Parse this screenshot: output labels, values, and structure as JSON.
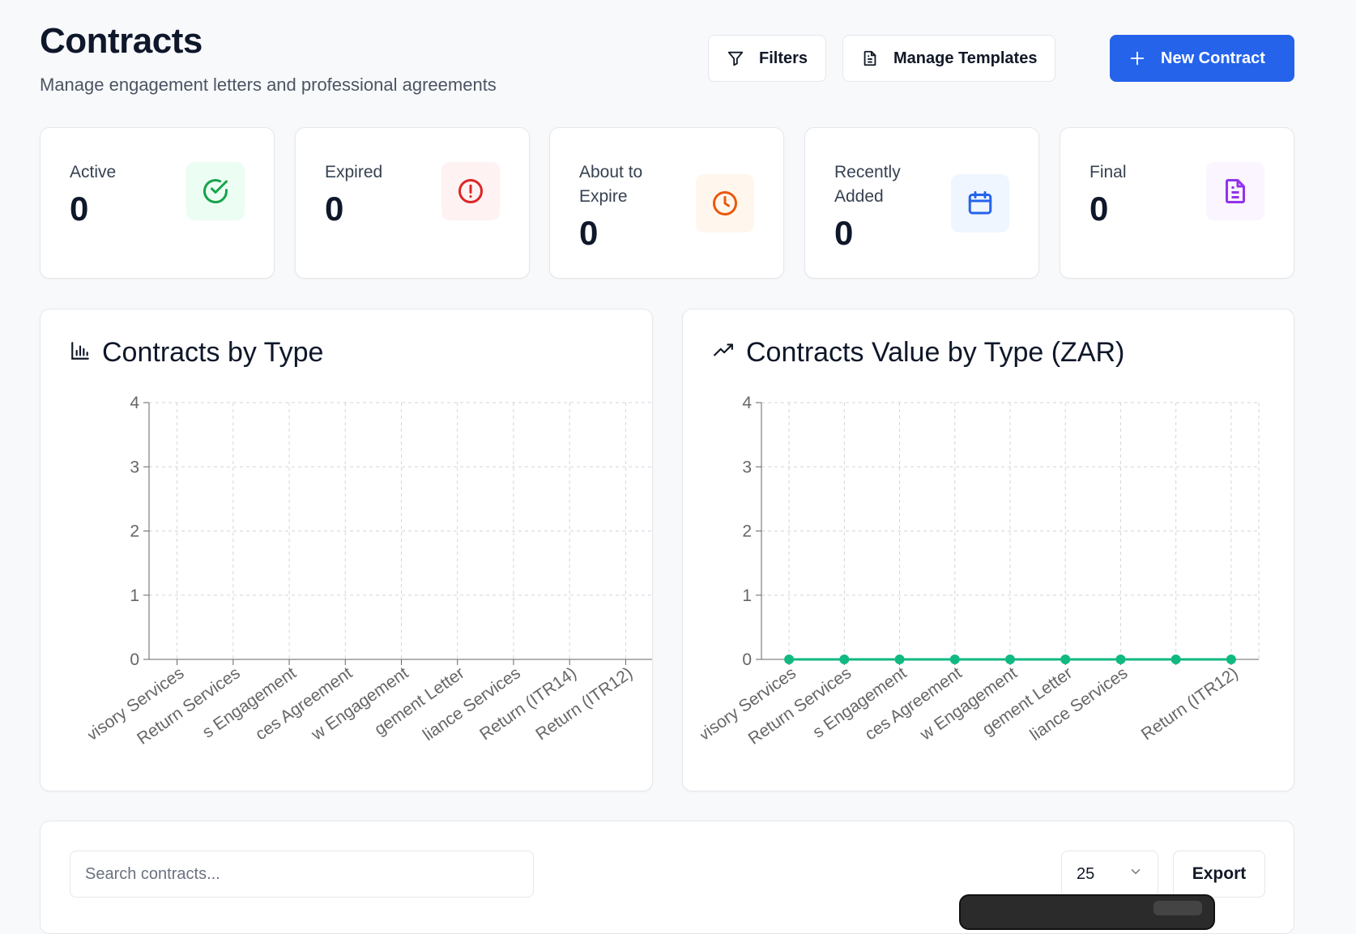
{
  "header": {
    "title": "Contracts",
    "subtitle": "Manage engagement letters and professional agreements",
    "buttons": {
      "filters": "Filters",
      "manage_templates": "Manage Templates",
      "new_contract": "New Contract"
    }
  },
  "stats": [
    {
      "label": "Active",
      "value": "0",
      "icon": "check-circle-icon",
      "color": "#16a34a",
      "bg": "#ecfdf3"
    },
    {
      "label": "Expired",
      "value": "0",
      "icon": "alert-circle-icon",
      "color": "#dc2626",
      "bg": "#fef2f2"
    },
    {
      "label": "About to Expire",
      "value": "0",
      "icon": "clock-icon",
      "color": "#ea580c",
      "bg": "#fff7ed"
    },
    {
      "label": "Recently Added",
      "value": "0",
      "icon": "calendar-icon",
      "color": "#2563eb",
      "bg": "#eff6ff"
    },
    {
      "label": "Final",
      "value": "0",
      "icon": "file-text-icon",
      "color": "#9333ea",
      "bg": "#faf5ff"
    }
  ],
  "charts": {
    "by_type_title": "Contracts by Type",
    "value_title": "Contracts Value by Type (ZAR)"
  },
  "chart_data": [
    {
      "type": "bar",
      "title": "Contracts by Type",
      "categories": [
        "visory Services",
        "Return Services",
        "s Engagement",
        "ces Agreement",
        "w Engagement",
        "gement Letter",
        "liance Services",
        "Return (ITR14)",
        "Return (ITR12)"
      ],
      "values": [
        0,
        0,
        0,
        0,
        0,
        0,
        0,
        0,
        0
      ],
      "yticks": [
        0,
        1,
        2,
        3,
        4
      ],
      "ylim": [
        0,
        4
      ],
      "grid": true
    },
    {
      "type": "line",
      "title": "Contracts Value by Type (ZAR)",
      "categories": [
        "visory Services",
        "Return Services",
        "s Engagement",
        "ces Agreement",
        "w Engagement",
        "gement Letter",
        "liance Services",
        "",
        "Return (ITR12)"
      ],
      "values": [
        0,
        0,
        0,
        0,
        0,
        0,
        0,
        0,
        0
      ],
      "yticks": [
        0,
        1,
        2,
        3,
        4
      ],
      "ylim": [
        0,
        4
      ],
      "grid": true,
      "color": "#10b981"
    }
  ],
  "table": {
    "search_placeholder": "Search contracts...",
    "page_size": "25",
    "export_label": "Export"
  }
}
